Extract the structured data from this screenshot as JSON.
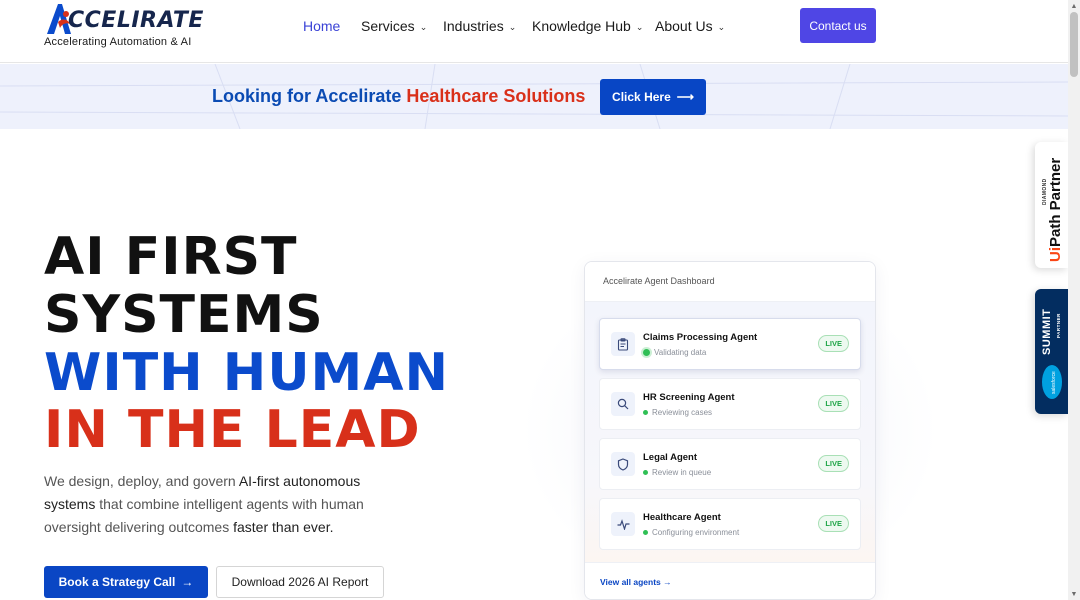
{
  "header": {
    "logo_text": "CCELIRATE",
    "logo_tagline": "Accelerating Automation & AI",
    "nav": [
      {
        "label": "Home",
        "dropdown": false,
        "active": true
      },
      {
        "label": "Services",
        "dropdown": true
      },
      {
        "label": "Industries",
        "dropdown": true
      },
      {
        "label": "Knowledge Hub",
        "dropdown": true
      },
      {
        "label": "About Us",
        "dropdown": true
      }
    ],
    "contact_label": "Contact us",
    "chevron": "⌄"
  },
  "banner": {
    "text_prefix": "Looking for Accelirate ",
    "text_highlight": "Healthcare Solutions",
    "button_label": "Click Here",
    "arrow": "⟶"
  },
  "hero": {
    "line1": "AI FIRST",
    "line2": "SYSTEMS",
    "line3": "WITH HUMAN",
    "line4": "IN THE LEAD",
    "desc_a": "We design, deploy, and govern ",
    "desc_b": "AI-first autonomous systems",
    "desc_c": " that combine intelligent agents with human oversight delivering outcomes ",
    "desc_d": "faster than ever.",
    "primary_button": "Book a Strategy Call",
    "primary_arrow": "→",
    "secondary_button": "Download 2026 AI Report"
  },
  "dashboard": {
    "title": "Accelirate Agent Dashboard",
    "agents": [
      {
        "name": "Claims Processing Agent",
        "status": "Validating data",
        "badge": "LIVE",
        "icon": "clipboard-icon"
      },
      {
        "name": "HR Screening Agent",
        "status": "Reviewing cases",
        "badge": "LIVE",
        "icon": "search-icon"
      },
      {
        "name": "Legal Agent",
        "status": "Review in queue",
        "badge": "LIVE",
        "icon": "shield-icon"
      },
      {
        "name": "Healthcare Agent",
        "status": "Configuring environment",
        "badge": "LIVE",
        "icon": "pulse-icon"
      }
    ],
    "view_all": "View all agents →"
  },
  "badges": {
    "uipath_tier": "DIAMOND",
    "uipath_ui": "Ui",
    "uipath_rest": "Path Partner",
    "sf_summit": "SUMMIT",
    "sf_partner": "PARTNER",
    "sf_cloud_text": "salesforce"
  },
  "scroll": {
    "up": "▲",
    "down": "▼"
  },
  "colors": {
    "brand_blue": "#0b4bcc",
    "brand_red": "#d8301a",
    "nav_active": "#3b43d6",
    "contact_bg": "#4f46e5",
    "live_green": "#20a548"
  }
}
